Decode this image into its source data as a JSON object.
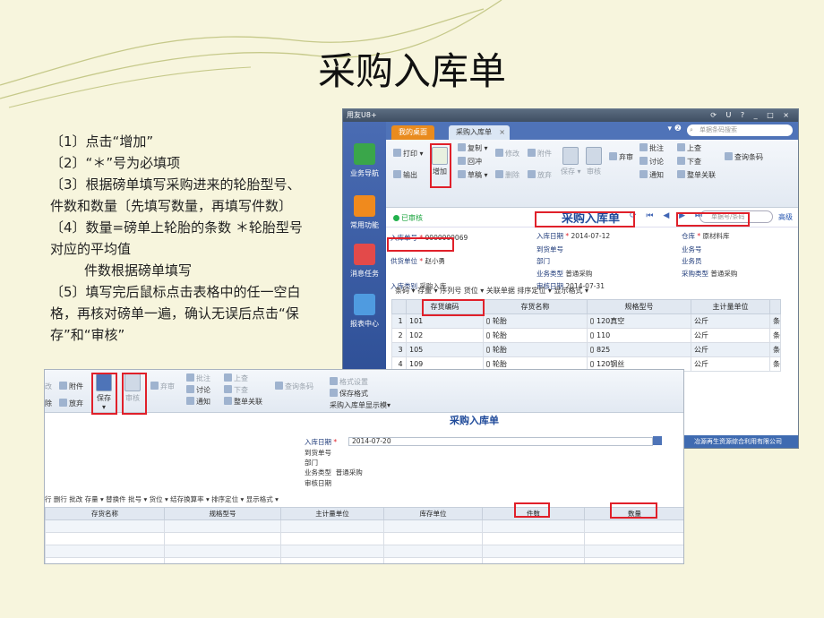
{
  "slide": {
    "title": "采购入库单",
    "steps": [
      "〔1〕点击“增加”",
      "〔2〕“＊”号为必填项",
      "〔3〕根据磅单填写采购进来的轮胎型号、件数和数量〔先填写数量，再填写件数〕",
      "〔4〕数量=磅单上轮胎的条数 ＊轮胎型号对应的平均值",
      "件数根据磅单填写",
      "〔5〕填写完后鼠标点击表格中的任一空白格，再核对磅单一遍，确认无误后点击“保存”和“审核”"
    ]
  },
  "upper_window": {
    "app_name": "用友U8+",
    "window_controls": "⟳ U ? _ □ ×",
    "sidebar": [
      {
        "label": "业务导航"
      },
      {
        "label": "常用功能"
      },
      {
        "label": "消息任务"
      },
      {
        "label": "报表中心"
      }
    ],
    "tabs": {
      "home": "我的桌面",
      "current": "采购入库单",
      "close": "×"
    },
    "help": "▾ ❷",
    "search_placeholder": "单据条码搜索",
    "toolbar": {
      "print": "打印",
      "output": "输出",
      "add": "增加",
      "copy": "复制",
      "draft": "草稿",
      "rush": "回冲",
      "modify": "修改",
      "attach": "附件",
      "delete": "删除",
      "release": "放弃",
      "save": "保存",
      "audit": "审核",
      "abandon": "弃审",
      "annotate": "批注",
      "discuss": "讨论",
      "notify": "通知",
      "prev": "上查",
      "next": "下查",
      "whole": "整单关联",
      "query_code": "查询条码"
    },
    "status": "已审核",
    "form_title": "采购入库单",
    "nav_icons": "⟳ ⏮ ◀ ▶ ⏭",
    "doc_search_placeholder": "单据号/条码",
    "advanced": "高级",
    "fields": {
      "in_no_label": "入库单号",
      "in_no": "0000000069",
      "in_date_label": "入库日期",
      "in_date": "2014-07-12",
      "warehouse_label": "仓库",
      "warehouse": "原材料库",
      "arrival_no_label": "到货单号",
      "arrival_no": "",
      "business_no_label": "业务号",
      "business_no": "",
      "supplier_label": "供货单位",
      "supplier": "赵小勇",
      "dept_label": "部门",
      "dept": "",
      "clerk_label": "业务员",
      "clerk": "",
      "biz_type_label": "业务类型",
      "biz_type": "普通采购",
      "purchase_type_label": "采购类型",
      "purchase_type": "普通采购",
      "in_type_label": "入库类别",
      "in_type": "采购入库",
      "audit_date_label": "审核日期",
      "audit_date": "2014-07-31"
    },
    "grid_toolbar": "条码 ▾  存量 ▾  序列号  货位 ▾  关联单据  排序定位 ▾  显示格式 ▾",
    "grid_headers": [
      "",
      "存货编码",
      "存货名称",
      "规格型号",
      "主计量单位",
      ""
    ],
    "grid_rows": [
      {
        "n": "1",
        "code": "101",
        "name": "轮胎",
        "spec": "120真空",
        "unit": "公斤",
        "extra": "条"
      },
      {
        "n": "2",
        "code": "102",
        "name": "轮胎",
        "spec": "110",
        "unit": "公斤",
        "extra": "条"
      },
      {
        "n": "3",
        "code": "105",
        "name": "轮胎",
        "spec": "825",
        "unit": "公斤",
        "extra": "条"
      },
      {
        "n": "4",
        "code": "109",
        "name": "轮胎",
        "spec": "120钢丝",
        "unit": "公斤",
        "extra": "条"
      }
    ],
    "footer": "冶源再生资源综合利用有限公司"
  },
  "lower_window": {
    "toolbar": {
      "modify": "改",
      "attach": "附件",
      "delete": "除",
      "release": "放弃",
      "save": "保存",
      "audit": "审核",
      "abandon": "弃审",
      "annotate": "批注",
      "discuss": "讨论",
      "notify": "通知",
      "prev": "上查",
      "next": "下查",
      "whole": "整单关联",
      "query_code": "查询条码",
      "format_settings": "格式设置",
      "save_format": "保存格式",
      "template": "采购入库单显示模▾"
    },
    "title": "采购入库单",
    "fields": {
      "in_date_label": "入库日期",
      "in_date": "2014-07-20",
      "arrival_no_label": "到货单号",
      "dept_label": "部门",
      "biz_type_label": "业务类型",
      "biz_type": "普通采购",
      "audit_date_label": "审核日期"
    },
    "grid_toolbar": "行   删行   批改   存量 ▾   替换件   批号 ▾   货位 ▾   结存换算率   ▾   排序定位 ▾   显示格式 ▾",
    "grid_headers": [
      "存货名称",
      "规格型号",
      "主计量单位",
      "库存单位",
      "件数",
      "数量"
    ]
  },
  "colors": {
    "accent_red": "#e0202a",
    "blue_title": "#1f4a9a",
    "slide_bg": "#f7f5dd"
  }
}
